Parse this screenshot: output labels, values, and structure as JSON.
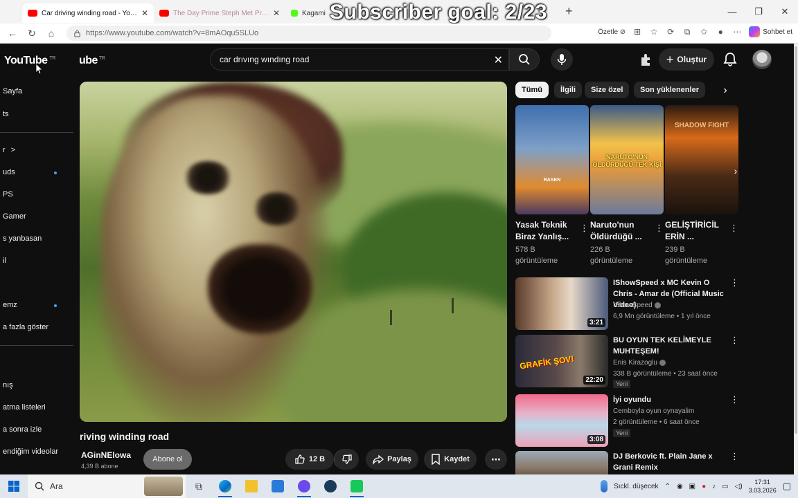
{
  "browser": {
    "tabs": [
      {
        "title": "Car driving winding road - YouTube",
        "active": true
      },
      {
        "title": "The Day Prime Steph Met Prime LeBron",
        "active": false
      },
      {
        "title": "Kagami",
        "active": false
      }
    ],
    "overlay_text": "Subscriber goal: 2/23",
    "url": "https://www.youtube.com/watch?v=8mAOqu5SLUo",
    "summarize_label": "Özetle",
    "copilot_label": "Sohbet et"
  },
  "youtube": {
    "logo": "YouTube",
    "logo_partial": "ube",
    "region": "TR",
    "search_value": "car drıvıng wındıng road",
    "create_label": "Oluştur",
    "sidebar": [
      {
        "label": "Sayfa",
        "dot": false
      },
      {
        "label": "ts",
        "dot": false
      },
      {
        "label": "r",
        "dot": false,
        "chevron": ">"
      },
      {
        "label": "uds",
        "dot": true
      },
      {
        "label": "PS",
        "dot": false
      },
      {
        "label": "Gamer",
        "dot": false
      },
      {
        "label": "s yanbasan",
        "dot": false
      },
      {
        "label": "il",
        "dot": false
      },
      {
        "label": "emz",
        "dot": true
      },
      {
        "label": "a fazla göster",
        "dot": false
      },
      {
        "label": "nış",
        "dot": false
      },
      {
        "label": "atma listeleri",
        "dot": false
      },
      {
        "label": "a sonra izle",
        "dot": false
      },
      {
        "label": "endiğim videolar",
        "dot": false
      }
    ],
    "video": {
      "title": "riving winding road",
      "channel": "AGinNElowa",
      "subscribers": "4,39 B abone",
      "subscribe_label": "Abone ol",
      "likes": "12 B",
      "share_label": "Paylaş",
      "save_label": "Kaydet"
    },
    "chips": [
      "Tümü",
      "İlgili",
      "Size özel",
      "Son yüklenenler"
    ],
    "shorts": [
      {
        "title": "Yasak Teknik Biraz Yanlış...",
        "views": "578 B görüntüleme",
        "thumb_text": "RASEN"
      },
      {
        "title": "Naruto'nun Öldürdüğü ...",
        "views": "226 B görüntüleme",
        "thumb_text": "NARUTO'NUN ÖLDÜRDÜĞÜ TEK KİŞİ"
      },
      {
        "title": "GELİŞTİRİCİL ERİN ...",
        "views": "239 B görüntüleme",
        "thumb_text": "SHADOW FIGHT"
      }
    ],
    "recommended": [
      {
        "title": "IShowSpeed x MC Kevin O Chris - Amar de (Official Music Video)",
        "channel": "IShowSpeed",
        "verified": true,
        "meta": "6,9 Mn görüntüleme • 1 yıl önce",
        "duration": "3:21",
        "new": "",
        "thumb_text": ""
      },
      {
        "title": "BU OYUN TEK KELİMEYLE MUHTEŞEM!",
        "channel": "Enis Kirazoglu",
        "verified": true,
        "meta": "338 B görüntüleme • 23 saat önce",
        "duration": "22:20",
        "new": "Yeni",
        "thumb_text": "GRAFİK ŞOV!"
      },
      {
        "title": "İyi oyundu",
        "channel": "Cemboyla oyun oynayalim",
        "verified": false,
        "meta": "2 görüntüleme • 6 saat önce",
        "duration": "3:08",
        "new": "Yeni",
        "thumb_text": ""
      },
      {
        "title": "DJ Berkovic ft. Plain Jane x Grani Remix",
        "channel": "",
        "verified": false,
        "meta": "",
        "duration": "",
        "new": "",
        "thumb_text": ""
      }
    ]
  },
  "taskbar": {
    "search_placeholder": "Ara",
    "weather": "Sıckl. düşecek",
    "time": "17:31",
    "date": "3.03.2026"
  }
}
